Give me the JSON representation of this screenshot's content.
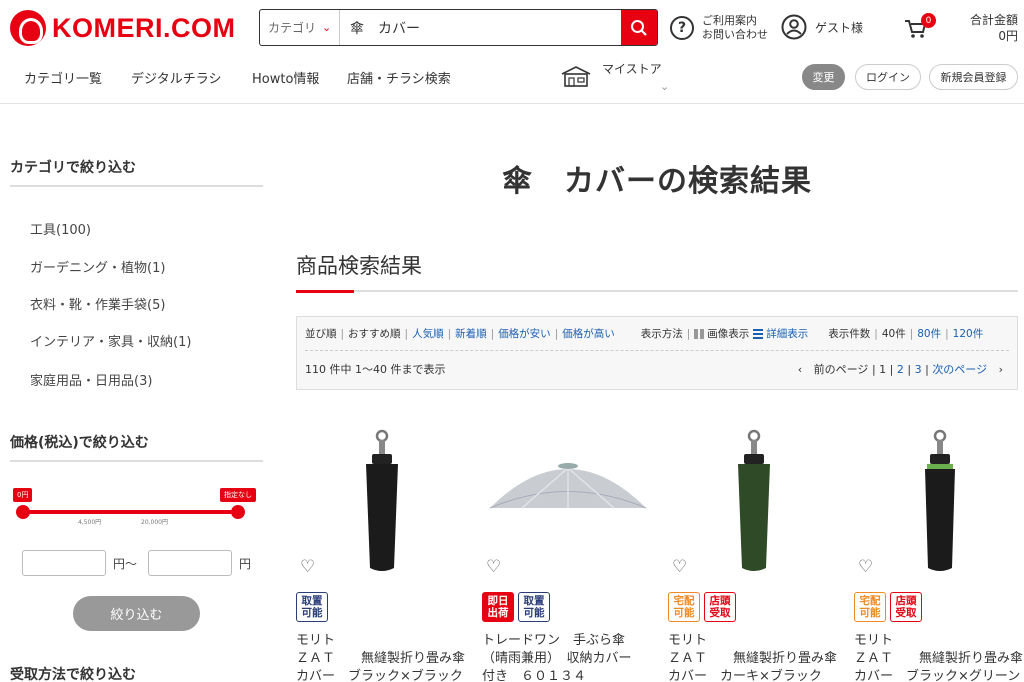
{
  "header": {
    "logo_text": "KOMERI.COM",
    "search": {
      "category_label": "カテゴリ",
      "query": "傘　カバー"
    },
    "help_line1": "ご利用案内",
    "help_line2": "お問い合わせ",
    "guest_label": "ゲスト様",
    "cart_count": "0",
    "total_label": "合計金額",
    "total_value": "0円",
    "brand_color": "#e60012"
  },
  "nav": {
    "items": [
      "カテゴリ一覧",
      "デジタルチラシ",
      "Howto情報",
      "店舗・チラシ検索"
    ],
    "mystore_label": "マイストア",
    "change_label": "変更",
    "login_label": "ログイン",
    "register_label": "新規会員登録"
  },
  "sidebar": {
    "category_heading": "カテゴリで絞り込む",
    "categories": [
      "工具(100)",
      "ガーデニング・植物(1)",
      "衣料・靴・作業手袋(5)",
      "インテリア・家具・収納(1)",
      "家庭用品・日用品(3)"
    ],
    "price_heading": "価格(税込)で絞り込む",
    "price_min_flag": "0円",
    "price_max_flag": "指定なし",
    "tick1": "4,500円",
    "tick2": "20,000円",
    "yen_from": "円〜",
    "yen_to": "円",
    "narrow_button": "絞り込む",
    "receive_heading": "受取方法で絞り込む"
  },
  "main": {
    "results_title": "傘　カバーの検索結果",
    "section_title": "商品検索結果",
    "sort": {
      "label": "並び順",
      "options": [
        "おすすめ順",
        "人気順",
        "新着順",
        "価格が安い",
        "価格が高い"
      ],
      "display_label": "表示方法",
      "display_image": "画像表示",
      "display_detail": "詳細表示",
      "count_label": "表示件数",
      "counts": [
        "40件",
        "80件",
        "120件"
      ]
    },
    "result_count": "110 件中 1〜40 件まで表示",
    "pager": {
      "prev": "前のページ",
      "pages": [
        "1",
        "2",
        "3"
      ],
      "next": "次のページ"
    }
  },
  "products": [
    {
      "name": "モリト\nＺＡＴ　　無縫製折り畳み傘\nカバー　ブラック×ブラック",
      "badges": [
        [
          "取置\n可能",
          "navy"
        ]
      ]
    },
    {
      "name": "トレードワン　手ぶら傘\n（晴雨兼用）　収納カバー\n付き　６０１３４",
      "badges": [
        [
          "即日\n出荷",
          "red"
        ],
        [
          "取置\n可能",
          "navy"
        ]
      ]
    },
    {
      "name": "モリト\nＺＡＴ　　無縫製折り畳み傘\nカバー　カーキ×ブラック",
      "badges": [
        [
          "宅配\n可能",
          "orange"
        ],
        [
          "店頭\n受取",
          "redline"
        ]
      ]
    },
    {
      "name": "モリト\nＺＡＴ　　無縫製折り畳み傘\nカバー　ブラック×グリーン",
      "badges": [
        [
          "宅配\n可能",
          "orange"
        ],
        [
          "店頭\n受取",
          "redline"
        ]
      ]
    }
  ]
}
